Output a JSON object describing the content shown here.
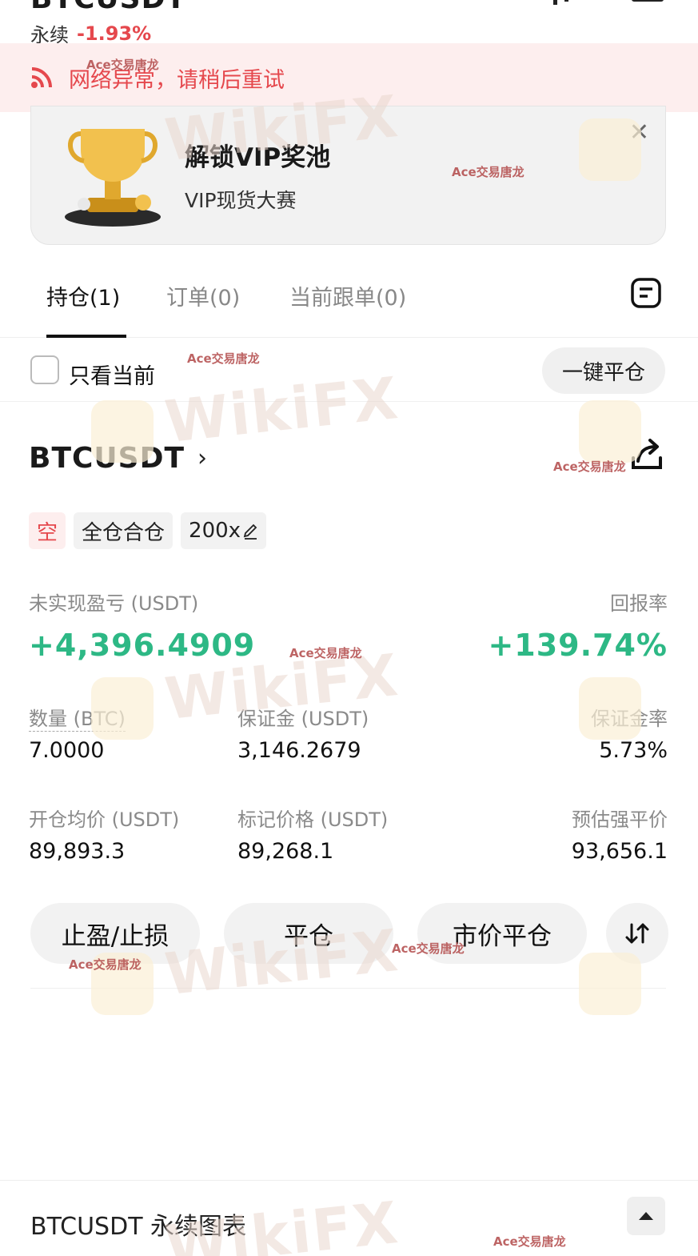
{
  "header": {
    "symbol": "BTCUSDT",
    "contract_type": "永续",
    "change_pct": "-1.93%"
  },
  "network_alert": {
    "text": "网络异常，请稍后重试"
  },
  "promo": {
    "title": "解锁VIP奖池",
    "subtitle": "VIP现货大赛"
  },
  "tabs": [
    {
      "label": "持仓(1)",
      "active": true
    },
    {
      "label": "订单(0)",
      "active": false
    },
    {
      "label": "当前跟单(0)",
      "active": false
    }
  ],
  "filter": {
    "only_current_label": "只看当前",
    "only_current_checked": false,
    "close_all_label": "一键平仓"
  },
  "position": {
    "symbol": "BTCUSDT",
    "side_tag": "空",
    "margin_mode_tag": "全仓合仓",
    "leverage_tag": "200x",
    "unrealized_pnl_label": "未实现盈亏 (USDT)",
    "unrealized_pnl": "+4,396.4909",
    "roe_label": "回报率",
    "roe": "+139.74%",
    "qty_label": "数量 (BTC)",
    "qty": "7.0000",
    "margin_label": "保证金 (USDT)",
    "margin": "3,146.2679",
    "margin_ratio_label": "保证金率",
    "margin_ratio": "5.73%",
    "entry_price_label": "开仓均价 (USDT)",
    "entry_price": "89,893.3",
    "mark_price_label": "标记价格 (USDT)",
    "mark_price": "89,268.1",
    "liq_price_label": "预估强平价",
    "liq_price": "93,656.1"
  },
  "actions": {
    "tp_sl": "止盈/止损",
    "close": "平仓",
    "market_close": "市价平仓"
  },
  "chart_section": {
    "title": "BTCUSDT 永续图表"
  },
  "watermark": {
    "text": "Ace交易唐龙",
    "brand": "WikiFX"
  },
  "colors": {
    "positive": "#2db885",
    "negative": "#e5484d",
    "alert_bg": "#fdeeee"
  },
  "icons": [
    "wifi-signal-icon",
    "trophy-icon",
    "close-icon",
    "list-icon",
    "chevron-right-icon",
    "share-icon",
    "edit-icon",
    "reverse-arrows-icon",
    "chevron-up-icon"
  ]
}
